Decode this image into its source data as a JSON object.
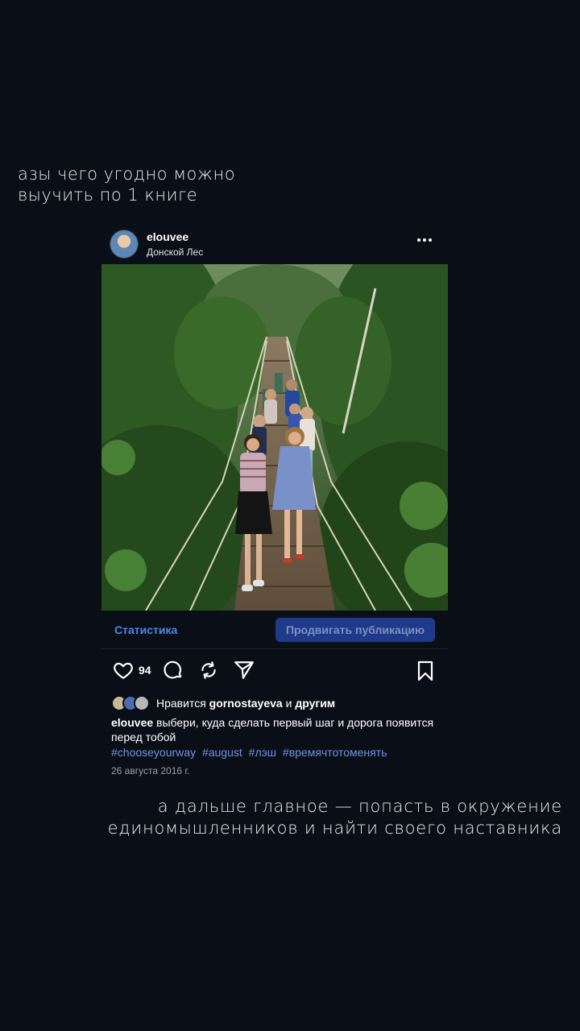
{
  "story": {
    "top_text": "азы чего угодно можно\nвыучить по 1 книге",
    "bottom_text": "а дальше главное — попасть в  окружение\nединомышленников и найти своего наставника"
  },
  "post": {
    "username": "elouvee",
    "location": "Донской Лес",
    "insights_label": "Статистика",
    "promote_label": "Продвигать публикацию",
    "likes_count": "94",
    "liked_by_prefix": "Нравится",
    "liked_by_user": "gornostayeva",
    "liked_by_and": "и",
    "liked_by_others": "другим",
    "caption_user": "elouvee",
    "caption_text": "выбери, куда сделать первый шаг и дорога появится перед тобой",
    "hashtags": [
      "#chooseyourway",
      "#august",
      "#лэш",
      "#времячтотоменять"
    ],
    "date": "26 августа 2016 г."
  },
  "icons": {
    "like": "heart-icon",
    "comment": "comment-icon",
    "repost": "repost-icon",
    "share": "send-icon",
    "save": "bookmark-icon",
    "more": "more-icon"
  },
  "colors": {
    "background": "#0a0e17",
    "link": "#4f86e8",
    "hashtag": "#6b94e6",
    "promote_bg": "#1f3a8a"
  }
}
